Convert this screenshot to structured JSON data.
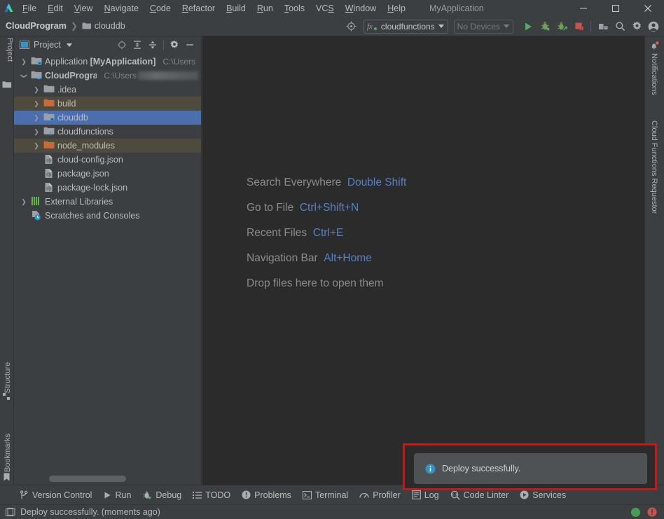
{
  "window": {
    "app_title": "MyApplication",
    "logo": "android-studio-logo-icon",
    "controls": [
      {
        "name": "minimize-button",
        "glyph": "—"
      },
      {
        "name": "maximize-button",
        "glyph": "☐"
      },
      {
        "name": "close-button",
        "glyph": "✕"
      }
    ]
  },
  "menubar": {
    "items": [
      {
        "label": "File",
        "mnemonic": "F"
      },
      {
        "label": "Edit",
        "mnemonic": "E"
      },
      {
        "label": "View",
        "mnemonic": "V"
      },
      {
        "label": "Navigate",
        "mnemonic": "N"
      },
      {
        "label": "Code",
        "mnemonic": "C"
      },
      {
        "label": "Refactor",
        "mnemonic": "R"
      },
      {
        "label": "Build",
        "mnemonic": "B"
      },
      {
        "label": "Run",
        "mnemonic": "R"
      },
      {
        "label": "Tools",
        "mnemonic": "T"
      },
      {
        "label": "VCS",
        "mnemonic": "S"
      },
      {
        "label": "Window",
        "mnemonic": "W"
      },
      {
        "label": "Help",
        "mnemonic": "H"
      }
    ]
  },
  "navbar": {
    "breadcrumb": [
      {
        "label": "CloudProgram",
        "bold": true,
        "icon": ""
      },
      {
        "label": "clouddb",
        "bold": false,
        "icon": "folder-icon"
      }
    ],
    "separator": "❯",
    "target_icon": "target-icon",
    "run_config": {
      "label": "cloudfunctions",
      "prefix_icon": "fx-icon",
      "dropdown": "chevron-down-icon"
    },
    "device_selector": {
      "label": "No Devices",
      "dropdown": "chevron-down-icon"
    },
    "actions": [
      {
        "name": "run-button",
        "icon": "play-icon",
        "color": "#59a869"
      },
      {
        "name": "debug-button",
        "icon": "bug-icon",
        "color": "#6e9f5a"
      },
      {
        "name": "attach-debugger-button",
        "icon": "bug-attach-icon",
        "color": "#6e9f5a"
      },
      {
        "name": "stop-button",
        "icon": "stop-icon",
        "color": "#c75450"
      },
      {
        "name": "device-manager-button",
        "icon": "device-manager-icon",
        "color": "#a0a5a8"
      },
      {
        "name": "search-everywhere-button",
        "icon": "search-icon",
        "color": "#a0a5a8"
      },
      {
        "name": "settings-button",
        "icon": "gear-icon",
        "color": "#a0a5a8"
      },
      {
        "name": "account-button",
        "icon": "avatar-icon",
        "color": "#a0a5a8"
      }
    ]
  },
  "left_stripe": {
    "top": [
      {
        "label": "Project",
        "icon": "project-icon",
        "active": true
      }
    ],
    "bottom": [
      {
        "label": "Structure",
        "icon": "structure-icon"
      },
      {
        "label": "Bookmarks",
        "icon": "bookmark-icon"
      }
    ]
  },
  "right_stripe": {
    "items": [
      {
        "label": "Notifications",
        "icon": "notifications-icon",
        "badge": true
      },
      {
        "label": "Cloud Functions Requestor",
        "icon": ""
      }
    ]
  },
  "project_panel": {
    "title": "Project",
    "title_icon": "project-window-icon",
    "dropdown": "chevron-down-icon",
    "actions": [
      {
        "name": "select-opened-file-button",
        "icon": "locate-icon"
      },
      {
        "name": "expand-all-button",
        "icon": "expand-all-icon"
      },
      {
        "name": "collapse-all-button",
        "icon": "collapse-all-icon"
      },
      {
        "name": "panel-settings-button",
        "icon": "gear-icon"
      },
      {
        "name": "hide-panel-button",
        "icon": "minus-icon"
      }
    ],
    "tree": [
      {
        "indent": 0,
        "arrow": "collapsed",
        "icon": "module-icon",
        "label": "Application",
        "bold_suffix": "[MyApplication]",
        "path": "C:\\Users",
        "redacted": false,
        "state": "normal"
      },
      {
        "indent": 0,
        "arrow": "expanded",
        "icon": "module-cloud-icon",
        "label": "CloudProgram",
        "bold": true,
        "path": "C:\\Users",
        "redacted": true,
        "state": "normal"
      },
      {
        "indent": 1,
        "arrow": "collapsed",
        "icon": "folder-icon",
        "label": ".idea",
        "state": "normal"
      },
      {
        "indent": 1,
        "arrow": "collapsed",
        "icon": "folder-orange-icon",
        "label": "build",
        "state": "highlight"
      },
      {
        "indent": 1,
        "arrow": "collapsed",
        "icon": "folder-module-icon",
        "label": "clouddb",
        "state": "selected"
      },
      {
        "indent": 1,
        "arrow": "collapsed",
        "icon": "folder-fx-icon",
        "label": "cloudfunctions",
        "state": "normal"
      },
      {
        "indent": 1,
        "arrow": "collapsed",
        "icon": "folder-orange-icon",
        "label": "node_modules",
        "state": "highlight"
      },
      {
        "indent": 1,
        "arrow": "none",
        "icon": "json-file-icon",
        "label": "cloud-config.json",
        "state": "normal"
      },
      {
        "indent": 1,
        "arrow": "none",
        "icon": "json-file-icon",
        "label": "package.json",
        "state": "normal"
      },
      {
        "indent": 1,
        "arrow": "none",
        "icon": "json-file-icon",
        "label": "package-lock.json",
        "state": "normal"
      },
      {
        "indent": 0,
        "arrow": "collapsed",
        "icon": "libraries-icon",
        "label": "External Libraries",
        "state": "normal"
      },
      {
        "indent": 0,
        "arrow": "none",
        "icon": "scratches-icon",
        "label": "Scratches and Consoles",
        "state": "normal"
      }
    ]
  },
  "editor": {
    "tips": [
      {
        "action": "Search Everywhere",
        "shortcut": "Double Shift"
      },
      {
        "action": "Go to File",
        "shortcut": "Ctrl+Shift+N"
      },
      {
        "action": "Recent Files",
        "shortcut": "Ctrl+E"
      },
      {
        "action": "Navigation Bar",
        "shortcut": "Alt+Home"
      },
      {
        "action": "Drop files here to open them",
        "shortcut": ""
      }
    ]
  },
  "toast": {
    "icon": "info-icon",
    "message": "Deploy successfully.",
    "highlight_color": "#ff0000"
  },
  "bottom_bar": {
    "items": [
      {
        "label": "Version Control",
        "icon": "branch-icon"
      },
      {
        "label": "Run",
        "icon": "play-icon"
      },
      {
        "label": "Debug",
        "icon": "bug-icon"
      },
      {
        "label": "TODO",
        "icon": "todo-icon"
      },
      {
        "label": "Problems",
        "icon": "problems-icon"
      },
      {
        "label": "Terminal",
        "icon": "terminal-icon"
      },
      {
        "label": "Profiler",
        "icon": "profiler-icon"
      },
      {
        "label": "Log",
        "icon": "log-icon"
      },
      {
        "label": "Code Linter",
        "icon": "linter-icon"
      },
      {
        "label": "Services",
        "icon": "services-icon"
      }
    ]
  },
  "status_bar": {
    "icon": "event-log-icon",
    "message": "Deploy successfully. (moments ago)",
    "indicators": [
      {
        "name": "status-ok-indicator",
        "icon": "green-dot-icon",
        "color": "#499c54"
      },
      {
        "name": "error-indicator",
        "icon": "error-circle-icon",
        "color": "#c75450"
      }
    ]
  }
}
